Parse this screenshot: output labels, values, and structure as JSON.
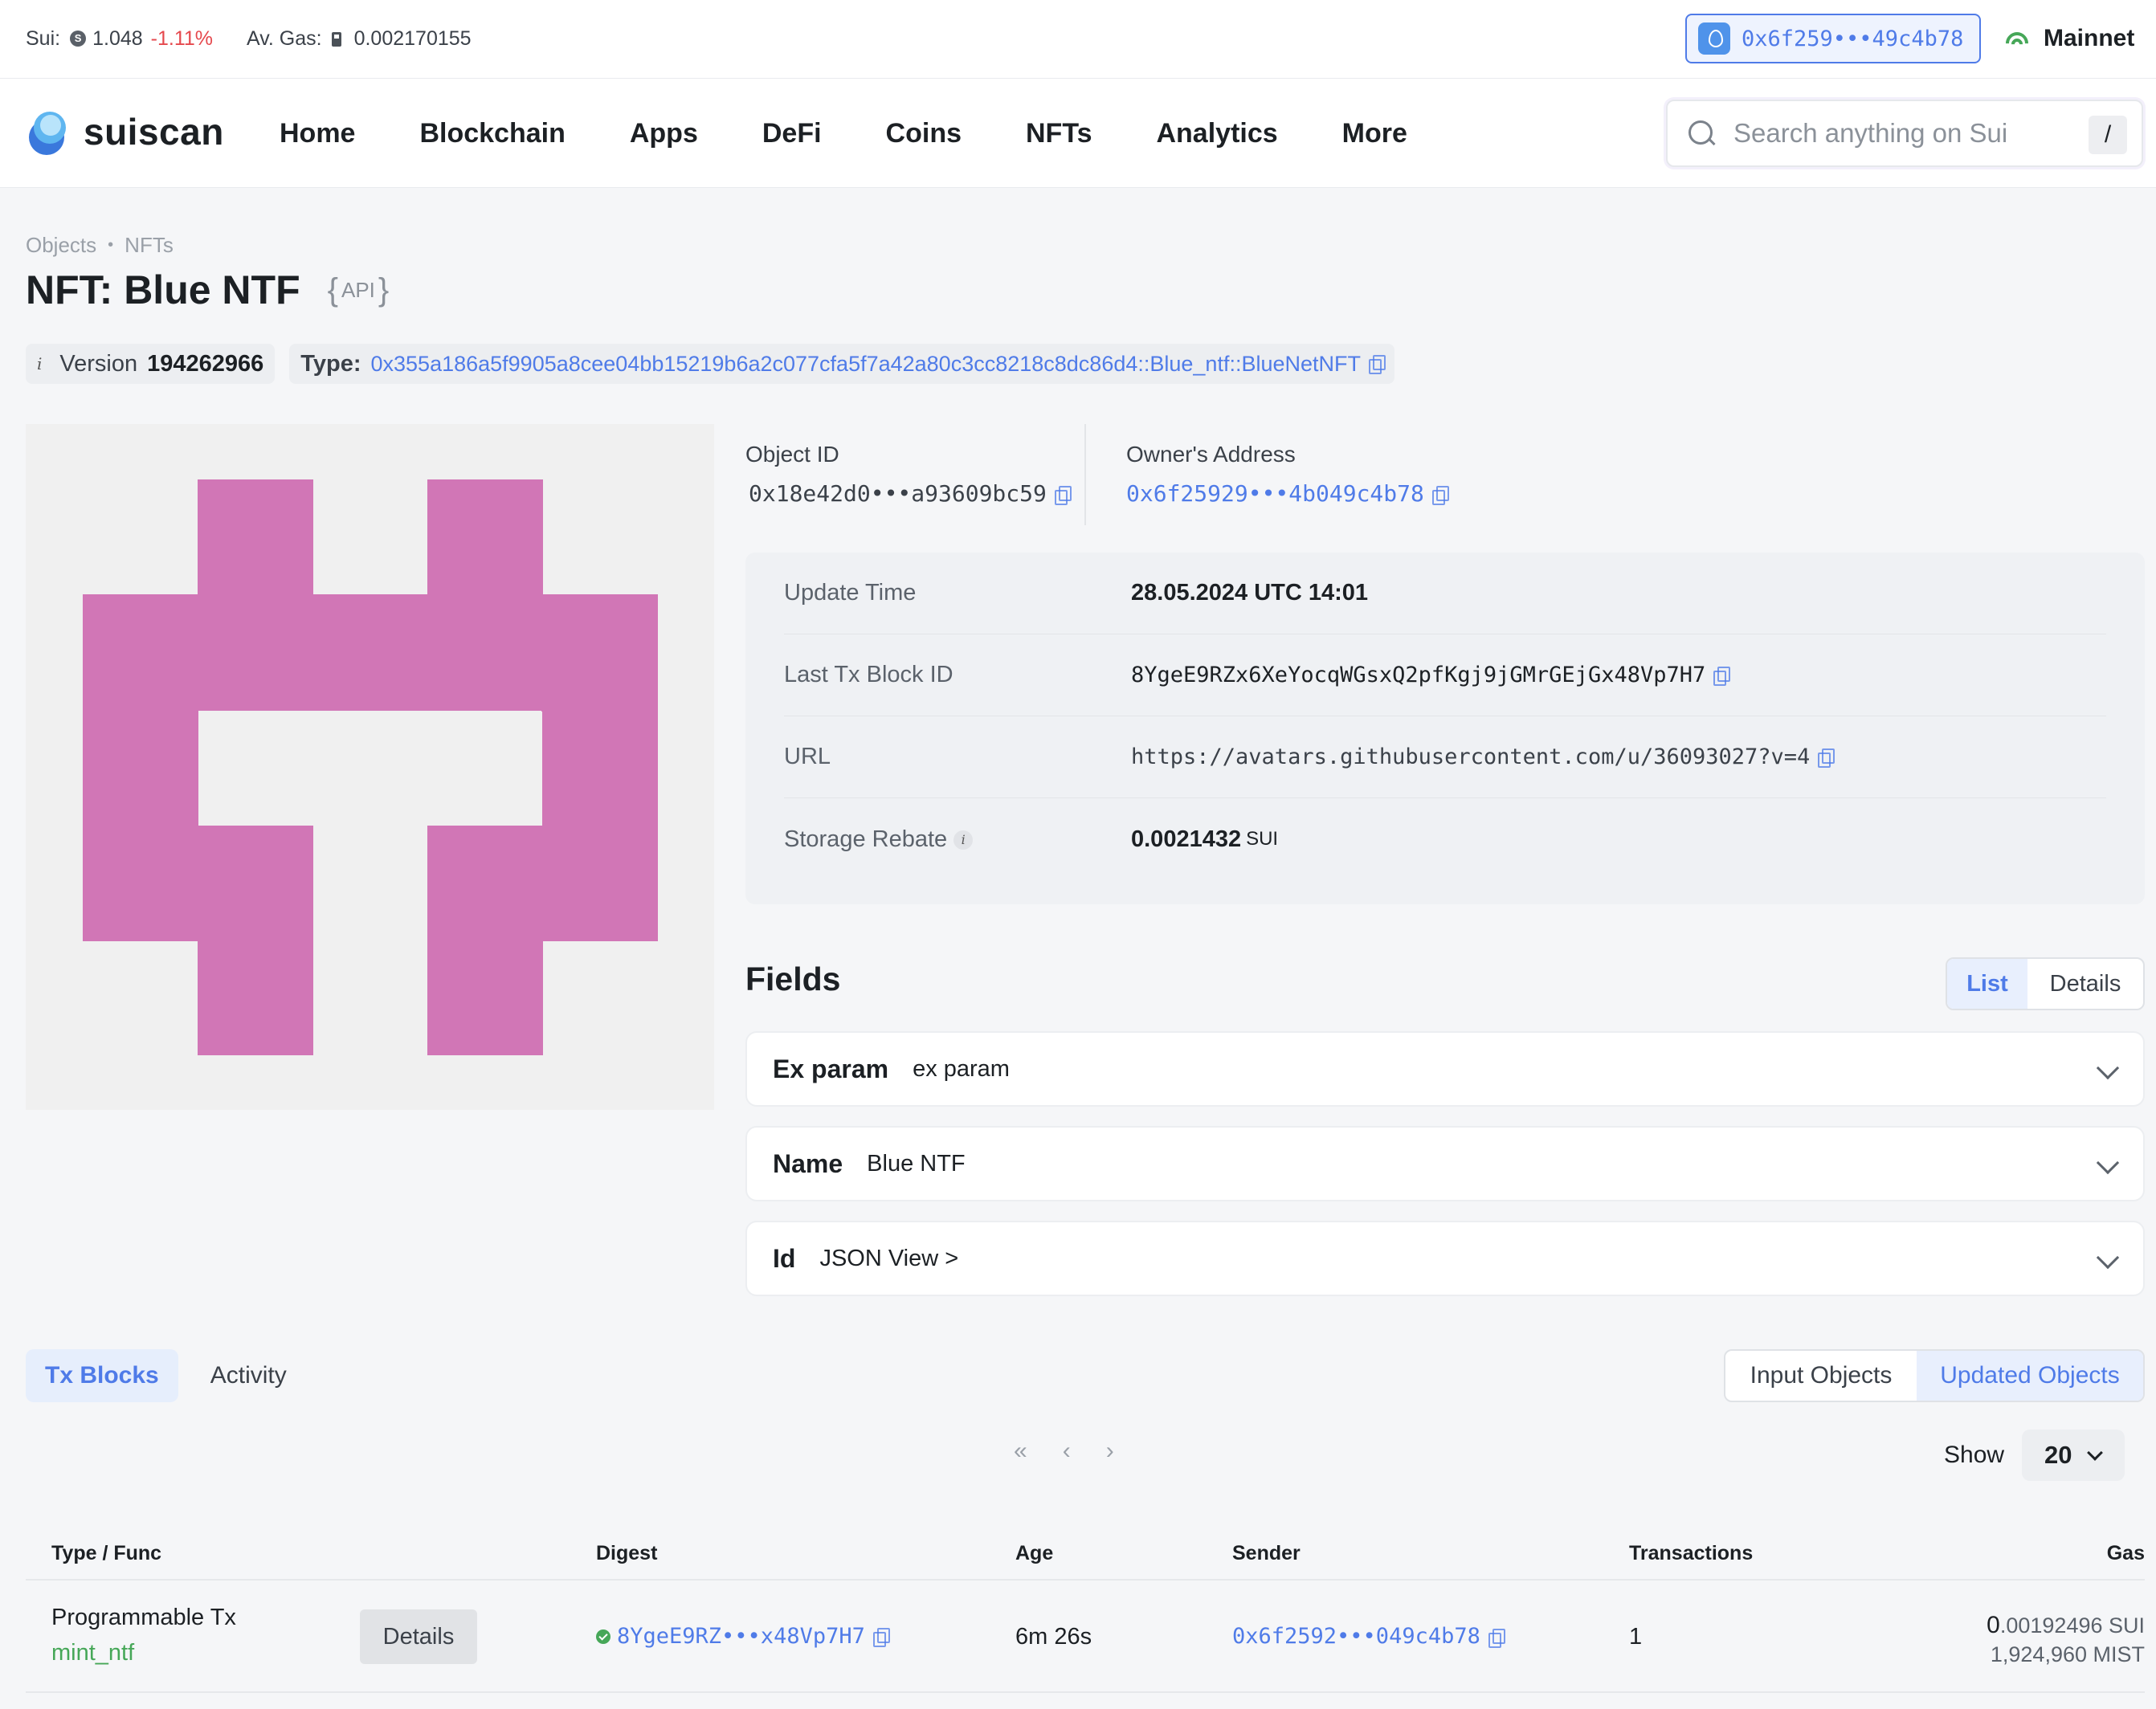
{
  "topbar": {
    "sui_label": "Sui:",
    "sui_price": "1.048",
    "sui_change": "-1.11%",
    "gas_label": "Av. Gas:",
    "gas_value": "0.002170155",
    "wallet": "0x6f259•••49c4b78",
    "network": "Mainnet"
  },
  "nav": {
    "logo": "suiscan",
    "items": [
      "Home",
      "Blockchain",
      "Apps",
      "DeFi",
      "Coins",
      "NFTs",
      "Analytics",
      "More"
    ],
    "search_placeholder": "Search anything on Sui",
    "search_shortcut": "/"
  },
  "breadcrumb": [
    "Objects",
    "NFTs"
  ],
  "page": {
    "title": "NFT: Blue NTF",
    "api_label": "API",
    "version_label": "Version",
    "version": "194262966",
    "type_label": "Type:",
    "type": "0x355a186a5f9905a8cee04bb15219b6a2c077cfa5f7a42a80c3cc8218c8dc86d4::Blue_ntf::BlueNetNFT"
  },
  "nft_image": {
    "fg": "#d176b6",
    "bg": "#f0f0f0"
  },
  "object": {
    "id_label": "Object ID",
    "id": "0x18e42d0•••a93609bc59",
    "owner_label": "Owner's Address",
    "owner": "0x6f25929•••4b049c4b78"
  },
  "properties": [
    {
      "key": "Update Time",
      "value": "28.05.2024 UTC 14:01"
    },
    {
      "key": "Last Tx Block ID",
      "value": "8YgeE9RZx6XeYocqWGsxQ2pfKgj9jGMrGEjGx48Vp7H7"
    },
    {
      "key": "URL",
      "value": "https://avatars.githubusercontent.com/u/36093027?v=4"
    },
    {
      "key": "Storage Rebate",
      "value": "0.0021432",
      "unit": "SUI"
    }
  ],
  "fields": {
    "title": "Fields",
    "toggle": [
      "List",
      "Details"
    ],
    "items": [
      {
        "key": "Ex param",
        "value": "ex param"
      },
      {
        "key": "Name",
        "value": "Blue NTF"
      },
      {
        "key": "Id",
        "value": "JSON View >"
      }
    ]
  },
  "tabs": [
    "Tx Blocks",
    "Activity"
  ],
  "object_toggle": [
    "Input Objects",
    "Updated Objects"
  ],
  "pager": {
    "first": "«",
    "prev": "‹",
    "next": "›",
    "show_label": "Show",
    "show_value": "20"
  },
  "table": {
    "headers": [
      "Type / Func",
      "Digest",
      "Age",
      "Sender",
      "Transactions",
      "Gas"
    ],
    "rows": [
      {
        "type": "Programmable Tx",
        "func": "mint_ntf",
        "details": "Details",
        "digest": "8YgeE9RZ•••x48Vp7H7",
        "age": "6m 26s",
        "sender": "0x6f2592•••049c4b78",
        "transactions": "1",
        "gas_int": "0",
        "gas_frac": ".00192496 SUI",
        "gas_mist": "1,924,960 MIST"
      }
    ]
  }
}
